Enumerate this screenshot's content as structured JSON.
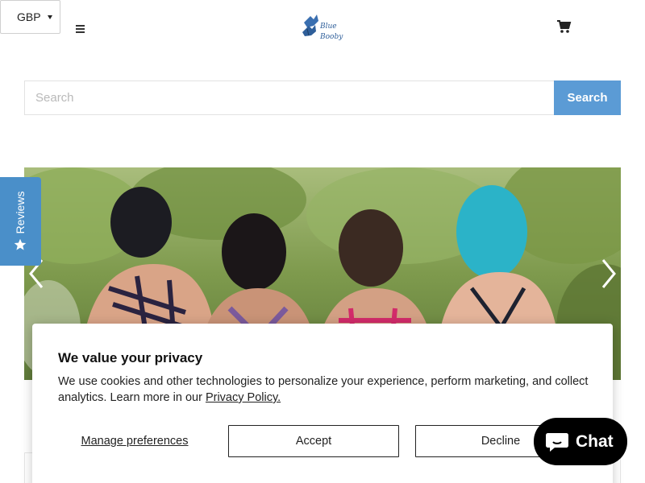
{
  "header": {
    "currency": "GBP",
    "logo_line1": "Blue",
    "logo_line2": "Booby"
  },
  "search": {
    "placeholder": "Search",
    "button_label": "Search"
  },
  "reviews_tab": {
    "label": "Reviews"
  },
  "privacy": {
    "title": "We value your privacy",
    "text": "We use cookies and other technologies to personalize your experience, perform marketing, and collect analytics. Learn more in our ",
    "link_text": "Privacy Policy.",
    "manage_label": "Manage preferences",
    "accept_label": "Accept",
    "decline_label": "Decline"
  },
  "chat": {
    "label": "Chat"
  },
  "colors": {
    "accent": "#5b9bd5",
    "reviews_tab": "#4a8fc9",
    "chat_bg": "#000000"
  },
  "icons": [
    "chevron-down-icon",
    "menu-icon",
    "cart-icon",
    "chevron-left-icon",
    "chevron-right-icon",
    "star-icon",
    "chat-bubble-icon"
  ]
}
